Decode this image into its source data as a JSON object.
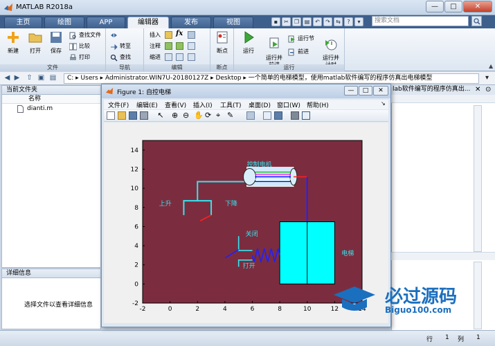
{
  "window": {
    "title": "MATLAB R2018a",
    "minimize": "—",
    "maximize": "□",
    "close": "✕"
  },
  "tabs": [
    {
      "label": "主页"
    },
    {
      "label": "绘图"
    },
    {
      "label": "APP"
    },
    {
      "label": "编辑器"
    },
    {
      "label": "发布"
    },
    {
      "label": "视图"
    }
  ],
  "search": {
    "placeholder": "搜索文档"
  },
  "ribbon": {
    "file_group": {
      "label": "文件",
      "new": "新建",
      "open": "打开",
      "save": "保存",
      "find_files": "查找文件",
      "compare": "比较",
      "print": "打印"
    },
    "nav_group": {
      "label": "导航",
      "goto": "转至",
      "find": "查找"
    },
    "edit_group": {
      "label": "编辑",
      "insert": "插入",
      "comment": "注释",
      "indent": "缩进",
      "fx": "fx"
    },
    "breakpoints_group": {
      "label": "断点",
      "breakpoints": "断点"
    },
    "run_group": {
      "label": "运行",
      "run": "运行",
      "run_advance": "运行并\n前进",
      "run_section": "运行节",
      "advance": "前进",
      "run_time": "运行并\n计时"
    }
  },
  "address": {
    "path": "C: ▸ Users ▸ Administrator.WIN7U-20180127Z ▸ Desktop ▸ 一个简单的电梯模型，使用matlab软件编写的程序仿真出电梯模型"
  },
  "current_folder": {
    "title": "当前文件夹",
    "column": "名称",
    "files": [
      "dianti.m"
    ]
  },
  "details": {
    "title": "详细信息",
    "hint": "选择文件以查看详细信息"
  },
  "editor_strip": {
    "text": "lab软件编写的程序仿真出..."
  },
  "status": {
    "row_label": "行",
    "row": "1",
    "col_label": "列",
    "col": "1"
  },
  "figure": {
    "title": "Figure 1: 自控电梯",
    "menus": [
      "文件(F)",
      "编辑(E)",
      "查看(V)",
      "插入(I)",
      "工具(T)",
      "桌面(D)",
      "窗口(W)",
      "帮助(H)"
    ],
    "plot": {
      "bg": "#7b2d3f",
      "xlim": [
        -2,
        14
      ],
      "ylim": [
        -2,
        15
      ],
      "xticks": [
        "-2",
        "0",
        "2",
        "4",
        "6",
        "8",
        "10",
        "12",
        "14"
      ],
      "yticks": [
        "-2",
        "0",
        "2",
        "4",
        "6",
        "8",
        "10",
        "12",
        "14"
      ],
      "labels": {
        "motor": "控制电机",
        "up": "上升",
        "down": "下降",
        "close": "关闭",
        "open": "打开",
        "elevator": "电梯"
      }
    }
  },
  "watermark": {
    "brand": "必过源码",
    "url": "Biguo100.com"
  }
}
